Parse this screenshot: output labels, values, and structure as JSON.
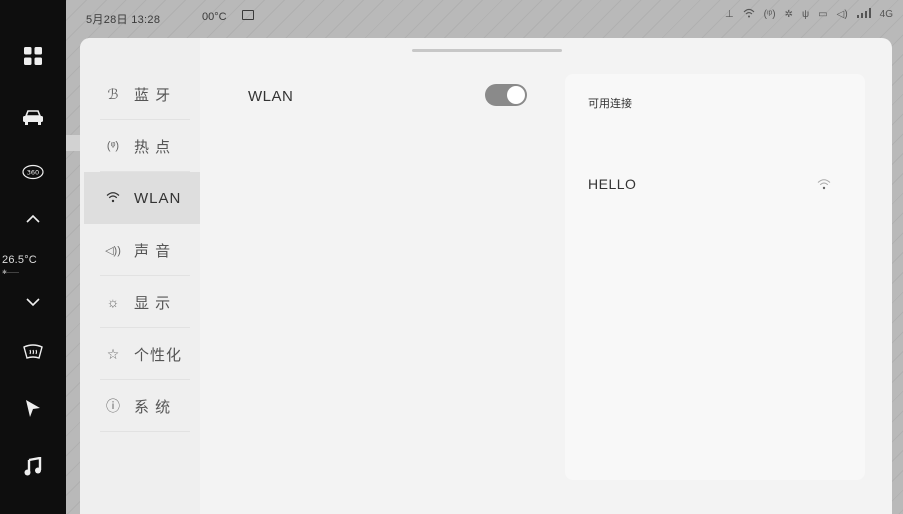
{
  "statusbar": {
    "datetime": "5月28日 13:28",
    "outside_temp": "00°C",
    "network": "4G"
  },
  "dock": {
    "temperature": "26.5°C",
    "fan_level_indicator": "✱------"
  },
  "nav": {
    "items": [
      {
        "icon": "bluetooth-icon",
        "label": "蓝 牙"
      },
      {
        "icon": "hotspot-icon",
        "label": "热 点"
      },
      {
        "icon": "wifi-icon",
        "label": "WLAN"
      },
      {
        "icon": "speaker-icon",
        "label": "声 音"
      },
      {
        "icon": "brightness-icon",
        "label": "显 示"
      },
      {
        "icon": "personalize-icon",
        "label": "个性化"
      },
      {
        "icon": "info-icon",
        "label": "系 统"
      }
    ],
    "active_index": 2
  },
  "main": {
    "wlan_label": "WLAN",
    "wlan_enabled": true
  },
  "available": {
    "title": "可用连接",
    "networks": [
      {
        "name": "HELLO",
        "signal": "wifi-signal-icon"
      }
    ]
  }
}
